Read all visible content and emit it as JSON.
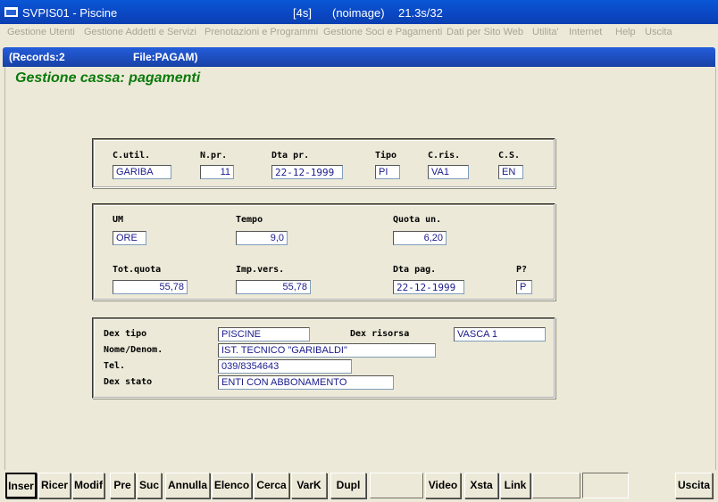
{
  "window": {
    "title": "SVPIS01 - Piscine",
    "timer": "[4s]",
    "image": "(noimage)",
    "timing": "21.3s/32"
  },
  "menu": [
    "Gestione Utenti",
    "Gestione Addetti e Servizi",
    "Prenotazioni e Programmi",
    "Gestione Soci e Pagamenti",
    "Dati per Sito Web",
    "Utilita'",
    "Internet",
    "Help",
    "Uscita"
  ],
  "status": {
    "records": "(Records:2",
    "file": "File:PAGAM)"
  },
  "page_title": "Gestione cassa: pagamenti",
  "section1": {
    "c_util": {
      "label": "C.util.",
      "value": "GARIBA"
    },
    "n_pr": {
      "label": "N.pr.",
      "value": "11"
    },
    "dta_pr": {
      "label": "Dta pr.",
      "value": "22-12-1999"
    },
    "tipo": {
      "label": "Tipo",
      "value": "PI"
    },
    "c_ris": {
      "label": "C.ris.",
      "value": "VA1"
    },
    "c_s": {
      "label": "C.S.",
      "value": "EN"
    }
  },
  "section2": {
    "um": {
      "label": "UM",
      "value": "ORE"
    },
    "tempo": {
      "label": "Tempo",
      "value": "9,0"
    },
    "quota_un": {
      "label": "Quota un.",
      "value": "6,20"
    },
    "tot_quota": {
      "label": "Tot.quota",
      "value": "55,78"
    },
    "imp_vers": {
      "label": "Imp.vers.",
      "value": "55,78"
    },
    "dta_pag": {
      "label": "Dta pag.",
      "value": "22-12-1999"
    },
    "p": {
      "label": "P?",
      "value": "P"
    }
  },
  "section3": {
    "dex_tipo": {
      "label": "Dex tipo",
      "value": "PISCINE"
    },
    "dex_risorsa": {
      "label": "Dex risorsa",
      "value": "VASCA 1"
    },
    "nome": {
      "label": "Nome/Denom.",
      "value": "IST. TECNICO \"GARIBALDI\""
    },
    "tel": {
      "label": "Tel.",
      "value": "039/8354643"
    },
    "dex_stato": {
      "label": "Dex stato",
      "value": "ENTI CON ABBONAMENTO"
    }
  },
  "toolbar": {
    "inser": "Inser",
    "ricer": "Ricer",
    "modif": "Modif",
    "pre": "Pre",
    "suc": "Suc",
    "annulla": "Annulla",
    "elenco": "Elenco",
    "cerca": "Cerca",
    "vark": "VarK",
    "dupl": "Dupl",
    "video": "Video",
    "xsta": "Xsta",
    "link": "Link",
    "uscita": "Uscita"
  }
}
